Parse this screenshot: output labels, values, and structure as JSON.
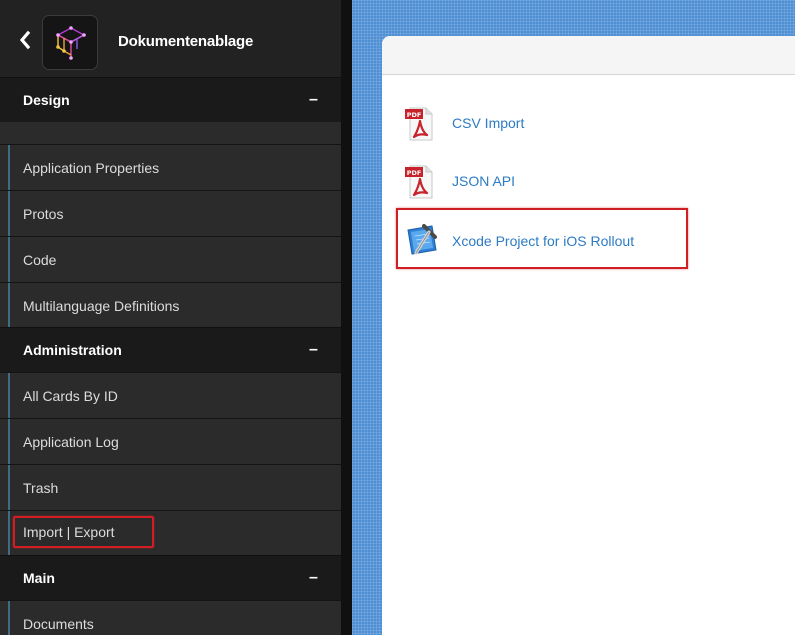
{
  "app": {
    "title": "Dokumentenablage"
  },
  "sidebar": {
    "sections": [
      {
        "title": "Design",
        "collapse_symbol": "–",
        "items": [
          {
            "label": "Application Properties"
          },
          {
            "label": "Protos"
          },
          {
            "label": "Code"
          },
          {
            "label": "Multilanguage Definitions"
          }
        ]
      },
      {
        "title": "Administration",
        "collapse_symbol": "–",
        "items": [
          {
            "label": "All Cards By ID"
          },
          {
            "label": "Application Log"
          },
          {
            "label": "Trash"
          },
          {
            "label": "Import | Export"
          }
        ]
      },
      {
        "title": "Main",
        "collapse_symbol": "–",
        "items": [
          {
            "label": "Documents"
          }
        ]
      }
    ]
  },
  "documents": [
    {
      "label": "CSV Import",
      "icon": "pdf-icon",
      "icon_badge": "PDF"
    },
    {
      "label": "JSON API",
      "icon": "pdf-icon",
      "icon_badge": "PDF"
    },
    {
      "label": "Xcode Project for iOS Rollout",
      "icon": "xcode-icon"
    }
  ],
  "colors": {
    "sidebar_bg": "#2b2b2b",
    "section_bg": "#1a1a1a",
    "accent_bar": "#3f6c80",
    "link": "#2c7bc4",
    "highlight": "#d01e25",
    "main_bg": "#4f8fd4"
  }
}
